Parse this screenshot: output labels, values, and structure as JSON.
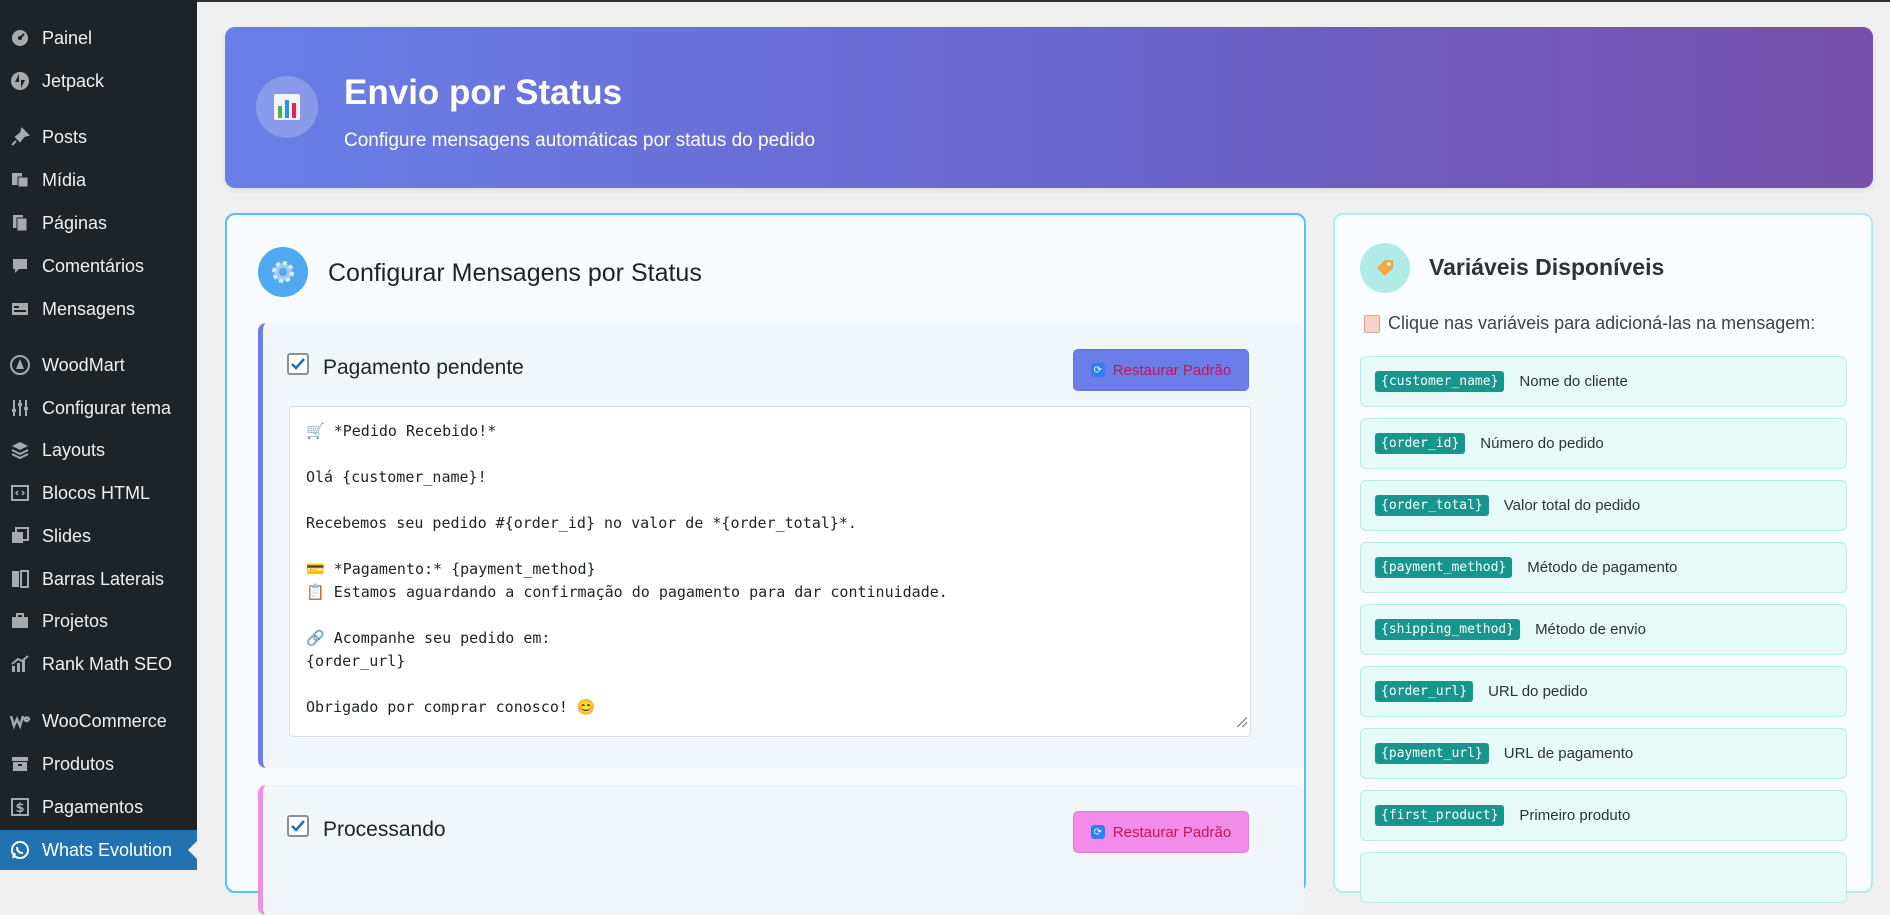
{
  "sidebar": {
    "items": [
      {
        "label": "Painel",
        "icon": "dashboard-icon"
      },
      {
        "label": "Jetpack",
        "icon": "jetpack-icon"
      },
      {
        "label": "Posts",
        "icon": "pin-icon"
      },
      {
        "label": "Mídia",
        "icon": "media-icon"
      },
      {
        "label": "Páginas",
        "icon": "pages-icon"
      },
      {
        "label": "Comentários",
        "icon": "comments-icon"
      },
      {
        "label": "Mensagens",
        "icon": "messages-icon"
      },
      {
        "label": "WoodMart",
        "icon": "woodmart-icon"
      },
      {
        "label": "Configurar tema",
        "icon": "sliders-icon"
      },
      {
        "label": "Layouts",
        "icon": "layers-icon"
      },
      {
        "label": "Blocos HTML",
        "icon": "code-icon"
      },
      {
        "label": "Slides",
        "icon": "slides-icon"
      },
      {
        "label": "Barras Laterais",
        "icon": "sidebar-icon"
      },
      {
        "label": "Projetos",
        "icon": "briefcase-icon"
      },
      {
        "label": "Rank Math SEO",
        "icon": "chart-icon"
      },
      {
        "label": "WooCommerce",
        "icon": "woocommerce-icon"
      },
      {
        "label": "Produtos",
        "icon": "archive-icon"
      },
      {
        "label": "Pagamentos",
        "icon": "dollar-icon"
      },
      {
        "label": "Whats Evolution",
        "icon": "whatsapp-icon"
      }
    ],
    "active": "Whats Evolution"
  },
  "banner": {
    "title": "Envio por Status",
    "subtitle": "Configure mensagens automáticas por status do pedido"
  },
  "config": {
    "title": "Configurar Mensagens por Status",
    "statuses": [
      {
        "label": "Pagamento pendente",
        "checked": true,
        "restore_label": "Restaurar Padrão",
        "button_color": "#6b7de8",
        "message": "🛒 *Pedido Recebido!*\n\nOlá {customer_name}!\n\nRecebemos seu pedido #{order_id} no valor de *{order_total}*.\n\n💳 *Pagamento:* {payment_method}\n📋 Estamos aguardando a confirmação do pagamento para dar continuidade.\n\n🔗 Acompanhe seu pedido em:\n{order_url}\n\nObrigado por comprar conosco! 😊"
      },
      {
        "label": "Processando",
        "checked": true,
        "restore_label": "Restaurar Padrão",
        "button_color": "#f38ce8"
      }
    ]
  },
  "variables": {
    "title": "Variáveis Disponíveis",
    "hint": "Clique nas variáveis para adicioná-las na mensagem:",
    "items": [
      {
        "tag": "{customer_name}",
        "desc": "Nome do cliente"
      },
      {
        "tag": "{order_id}",
        "desc": "Número do pedido"
      },
      {
        "tag": "{order_total}",
        "desc": "Valor total do pedido"
      },
      {
        "tag": "{payment_method}",
        "desc": "Método de pagamento"
      },
      {
        "tag": "{shipping_method}",
        "desc": "Método de envio"
      },
      {
        "tag": "{order_url}",
        "desc": "URL do pedido"
      },
      {
        "tag": "{payment_url}",
        "desc": "URL de pagamento"
      },
      {
        "tag": "{first_product}",
        "desc": "Primeiro produto"
      }
    ]
  }
}
